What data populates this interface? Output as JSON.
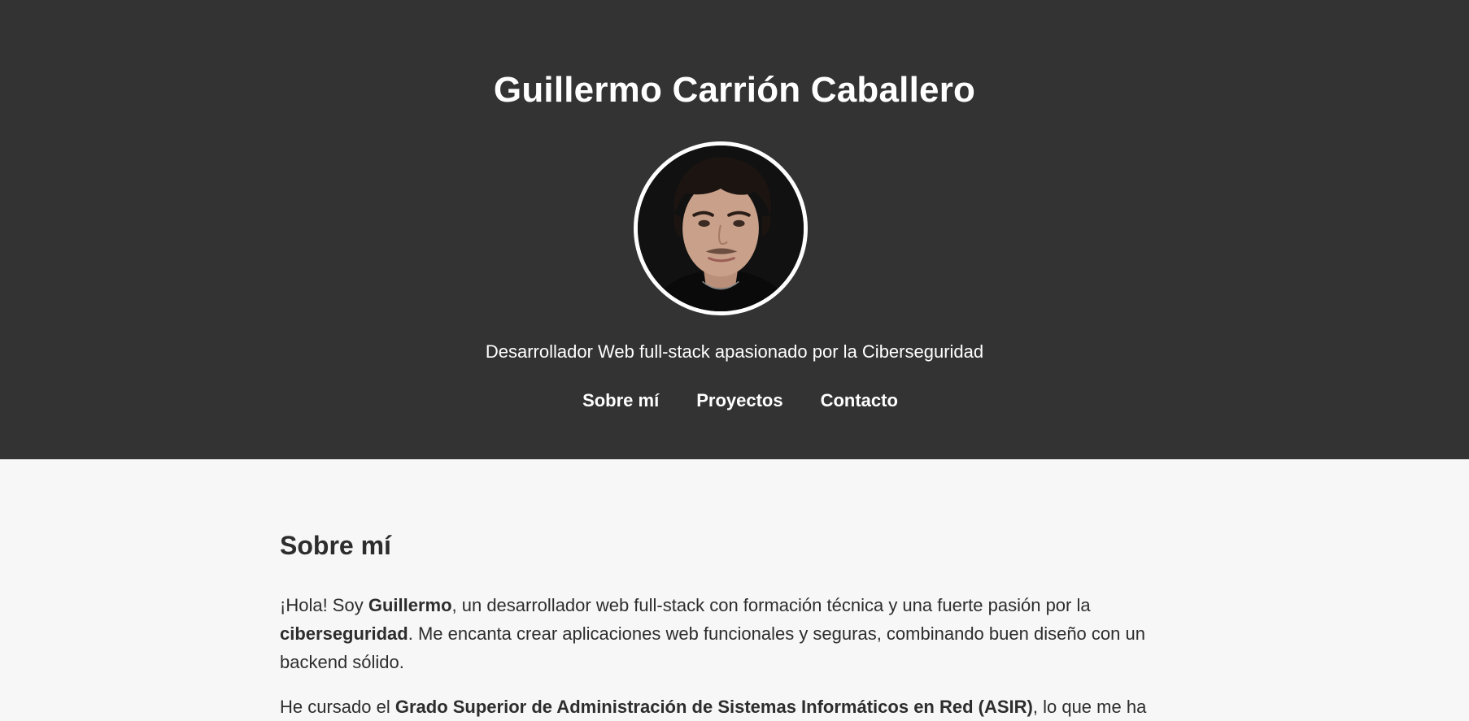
{
  "header": {
    "name": "Guillermo Carrión Caballero",
    "tagline": "Desarrollador Web full-stack apasionado por la Ciberseguridad",
    "avatar_icon": "profile-photo"
  },
  "nav": {
    "items": [
      {
        "label": "Sobre mí"
      },
      {
        "label": "Proyectos"
      },
      {
        "label": "Contacto"
      }
    ]
  },
  "about": {
    "title": "Sobre mí",
    "p1": {
      "t1": "¡Hola! Soy ",
      "b1": "Guillermo",
      "t2": ", un desarrollador web full-stack con formación técnica y una fuerte pasión por la ",
      "b2": "ciberseguridad",
      "t3": ". Me encanta crear aplicaciones web funcionales y seguras, combinando buen diseño con un backend sólido."
    },
    "p2": {
      "t1": "He cursado el ",
      "b1": "Grado Superior de Administración de Sistemas Informáticos en Red (ASIR)",
      "t2": ", lo que me ha"
    }
  },
  "colors": {
    "hero_bg": "#333333",
    "page_bg": "#f7f7f7",
    "text_dark": "#2d2d2d",
    "text_light": "#ffffff"
  }
}
